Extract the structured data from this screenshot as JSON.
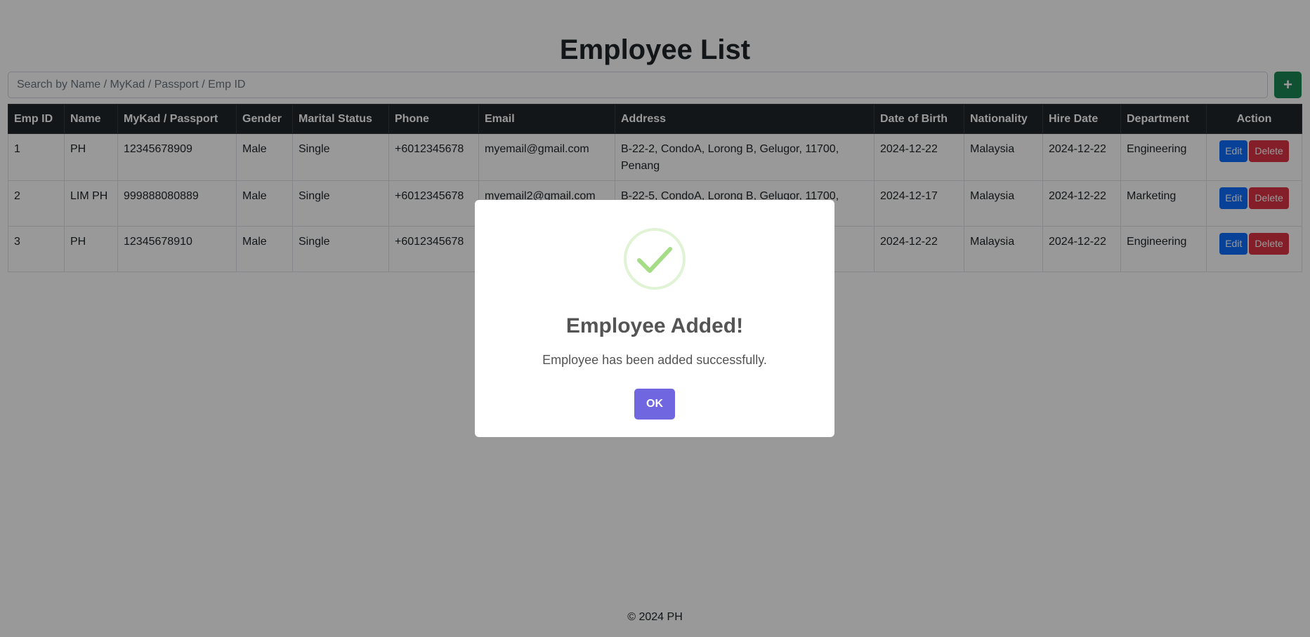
{
  "page": {
    "title": "Employee List",
    "footer": "© 2024 PH"
  },
  "search": {
    "placeholder": "Search by Name / MyKad / Passport / Emp ID",
    "value": ""
  },
  "add_button": {
    "icon": "plus-icon",
    "label": "+"
  },
  "table": {
    "headers": {
      "emp_id": "Emp ID",
      "name": "Name",
      "mykad": "MyKad / Passport",
      "gender": "Gender",
      "marital": "Marital Status",
      "phone": "Phone",
      "email": "Email",
      "address": "Address",
      "dob": "Date of Birth",
      "nationality": "Nationality",
      "hire_date": "Hire Date",
      "department": "Department",
      "action": "Action"
    },
    "rows": [
      {
        "emp_id": "1",
        "name": "PH",
        "mykad": "12345678909",
        "gender": "Male",
        "marital": "Single",
        "phone": "+6012345678",
        "email": "myemail@gmail.com",
        "address": "B-22-2, CondoA, Lorong B, Gelugor, 11700, Penang",
        "dob": "2024-12-22",
        "nationality": "Malaysia",
        "hire_date": "2024-12-22",
        "department": "Engineering"
      },
      {
        "emp_id": "2",
        "name": "LIM PH",
        "mykad": "999888080889",
        "gender": "Male",
        "marital": "Single",
        "phone": "+6012345678",
        "email": "myemail2@gmail.com",
        "address": "B-22-5, CondoA, Lorong B, Gelugor, 11700,",
        "dob": "2024-12-17",
        "nationality": "Malaysia",
        "hire_date": "2024-12-22",
        "department": "Marketing"
      },
      {
        "emp_id": "3",
        "name": "PH",
        "mykad": "12345678910",
        "gender": "Male",
        "marital": "Single",
        "phone": "+6012345678",
        "email": "",
        "address": "",
        "dob": "2024-12-22",
        "nationality": "Malaysia",
        "hire_date": "2024-12-22",
        "department": "Engineering"
      }
    ],
    "actions": {
      "edit_label": "Edit",
      "delete_label": "Delete"
    }
  },
  "modal": {
    "icon": "success-check-icon",
    "title": "Employee Added!",
    "text": "Employee has been added successfully.",
    "ok_label": "OK"
  },
  "colors": {
    "header_bg": "#212529",
    "add_button": "#198754",
    "edit_button": "#0d6efd",
    "delete_button": "#dc3545",
    "ok_button": "#7066e0",
    "success_check": "#a5dc86"
  }
}
